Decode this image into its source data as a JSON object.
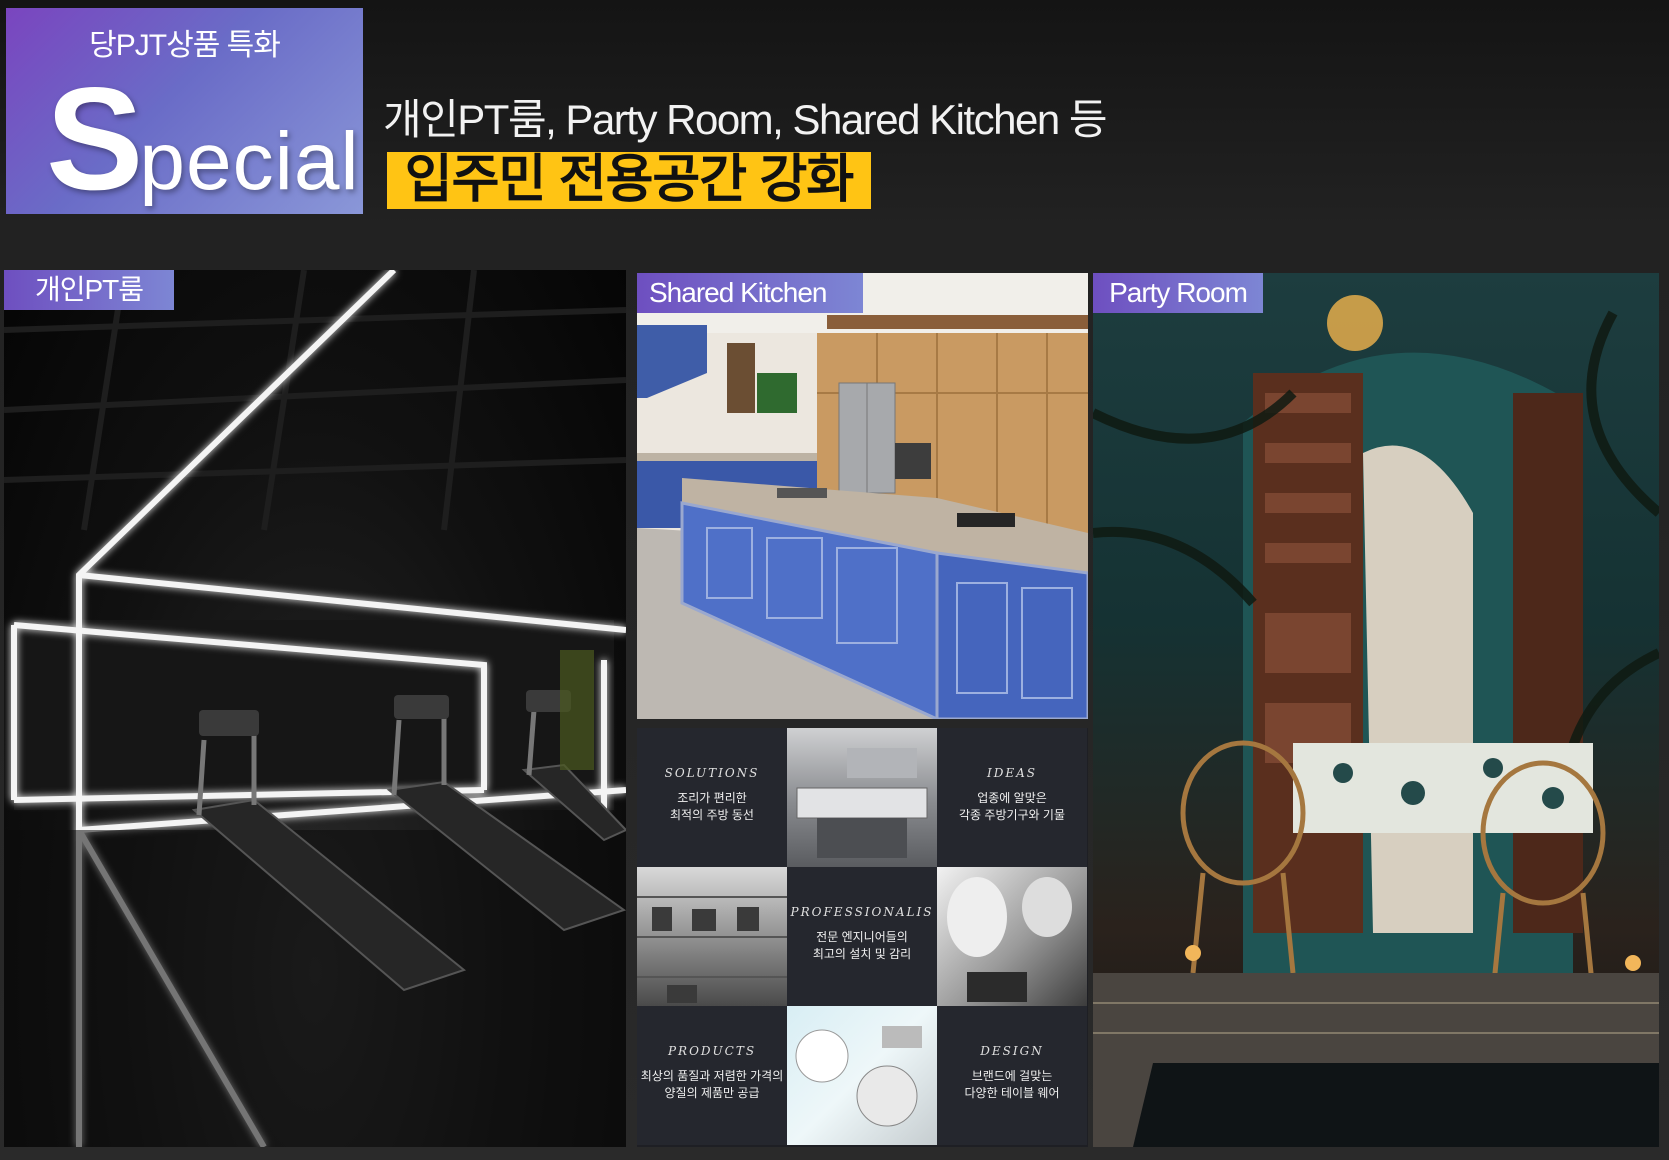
{
  "hero": {
    "subtitle": "당PJT상품 특화",
    "word_initial": "S",
    "word_rest": "pecial"
  },
  "headline": "개인PT룸, Party Room, Shared Kitchen 등",
  "highlight": "입주민 전용공간 강화",
  "panels": {
    "pt_label": "개인PT룸",
    "kitchen_label": "Shared Kitchen",
    "party_label": "Party Room"
  },
  "kitchen_grid": {
    "solutions": {
      "title": "SOLUTIONS",
      "line1": "조리가 편리한",
      "line2": "최적의 주방 동선"
    },
    "ideas": {
      "title": "IDEAS",
      "line1": "업종에 알맞은",
      "line2": "각종 주방기구와 기물"
    },
    "professionals": {
      "title": "PROFESSIONALIS",
      "line1": "전문 엔지니어들의",
      "line2": "최고의 설치 및 감리"
    },
    "products": {
      "title": "PRODUCTS",
      "line1": "최상의 품질과 저렴한 가격의",
      "line2": "양질의 제품만 공급"
    },
    "design": {
      "title": "DESIGN",
      "line1": "브랜드에 걸맞는",
      "line2": "다양한 테이블 웨어"
    }
  }
}
